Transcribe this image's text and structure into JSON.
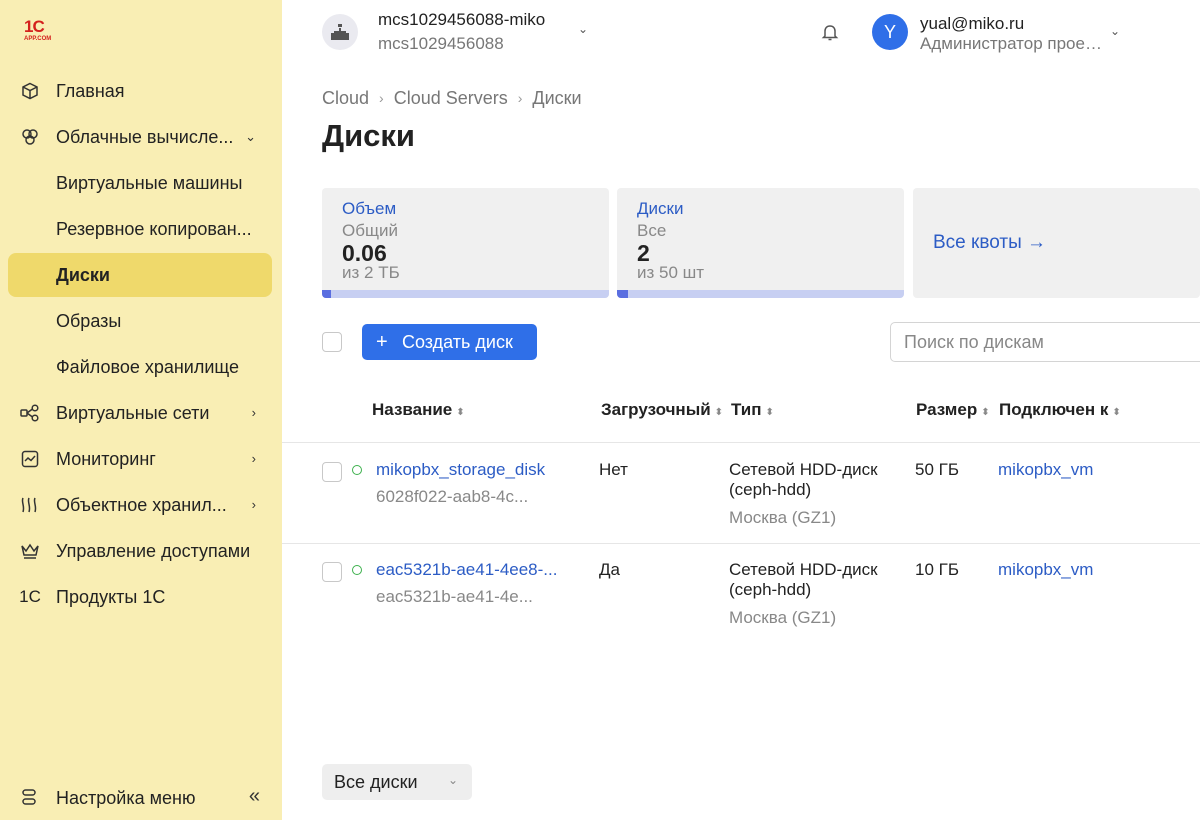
{
  "brand": {
    "logo_top": "1С",
    "logo_bottom": "APP.COM"
  },
  "sidebar": {
    "items": [
      {
        "label": "Главная",
        "icon": "cube-icon"
      },
      {
        "label": "Облачные вычисле...",
        "icon": "cloud-compute-icon",
        "chevron": "⌄"
      },
      {
        "label": "Виртуальные машины"
      },
      {
        "label": "Резервное копирован..."
      },
      {
        "label": "Диски"
      },
      {
        "label": "Образы"
      },
      {
        "label": "Файловое хранилище"
      },
      {
        "label": "Виртуальные сети",
        "icon": "network-icon",
        "chevron": "›"
      },
      {
        "label": "Мониторинг",
        "icon": "chart-icon",
        "chevron": "›"
      },
      {
        "label": "Объектное хранил...",
        "icon": "object-storage-icon",
        "chevron": "›"
      },
      {
        "label": "Управление доступами",
        "icon": "crown-icon"
      },
      {
        "label": "Продукты 1С",
        "icon": "1c-icon",
        "icon_text": "1С"
      }
    ],
    "footer": {
      "label": "Настройка меню",
      "collapse": "«"
    }
  },
  "header": {
    "project_name": "mcs1029456088-miko",
    "project_id": "mcs1029456088",
    "user_initial": "Y",
    "user_email": "yual@miko.ru",
    "user_role": "Администратор проекта",
    "dropdown": "⌄"
  },
  "breadcrumb": {
    "items": [
      "Cloud",
      "Cloud Servers",
      "Диски"
    ],
    "separator": "›"
  },
  "page_title": "Диски",
  "quotas": [
    {
      "title": "Объем",
      "sub": "Общий",
      "value": "0.06",
      "limit": "из 2 ТБ",
      "fraction": 0.03
    },
    {
      "title": "Диски",
      "sub": "Все",
      "value": "2",
      "limit": "из 50 шт",
      "fraction": 0.04
    }
  ],
  "all_quotas": "Все квоты →",
  "toolbar": {
    "create_plus": "+",
    "create_label": "Создать диск",
    "search_placeholder": "Поиск по дискам"
  },
  "table": {
    "columns": [
      "Название",
      "Загрузочный",
      "Тип",
      "Размер",
      "Подключен к"
    ],
    "sort_glyph": "⬍",
    "rows": [
      {
        "name": "mikopbx_storage_disk",
        "id": "6028f022-aab8-4c...",
        "bootable": "Нет",
        "type_line1": "Сетевой HDD-диск",
        "type_line2": "(ceph-hdd)",
        "zone": "Москва (GZ1)",
        "size": "50 ГБ",
        "attached": "mikopbx_vm"
      },
      {
        "name": "eac5321b-ae41-4ee8-...",
        "id": "eac5321b-ae41-4e...",
        "bootable": "Да",
        "type_line1": "Сетевой HDD-диск",
        "type_line2": "(ceph-hdd)",
        "zone": "Москва (GZ1)",
        "size": "10 ГБ",
        "attached": "mikopbx_vm"
      }
    ]
  },
  "filter": {
    "label": "Все диски",
    "chevron": "⌄"
  },
  "colors": {
    "sidebar_bg": "#f9eeb4",
    "active_item": "#efd96b",
    "accent": "#2f6fe8",
    "link": "#2c5cc5",
    "status_ok": "#3db14d"
  }
}
